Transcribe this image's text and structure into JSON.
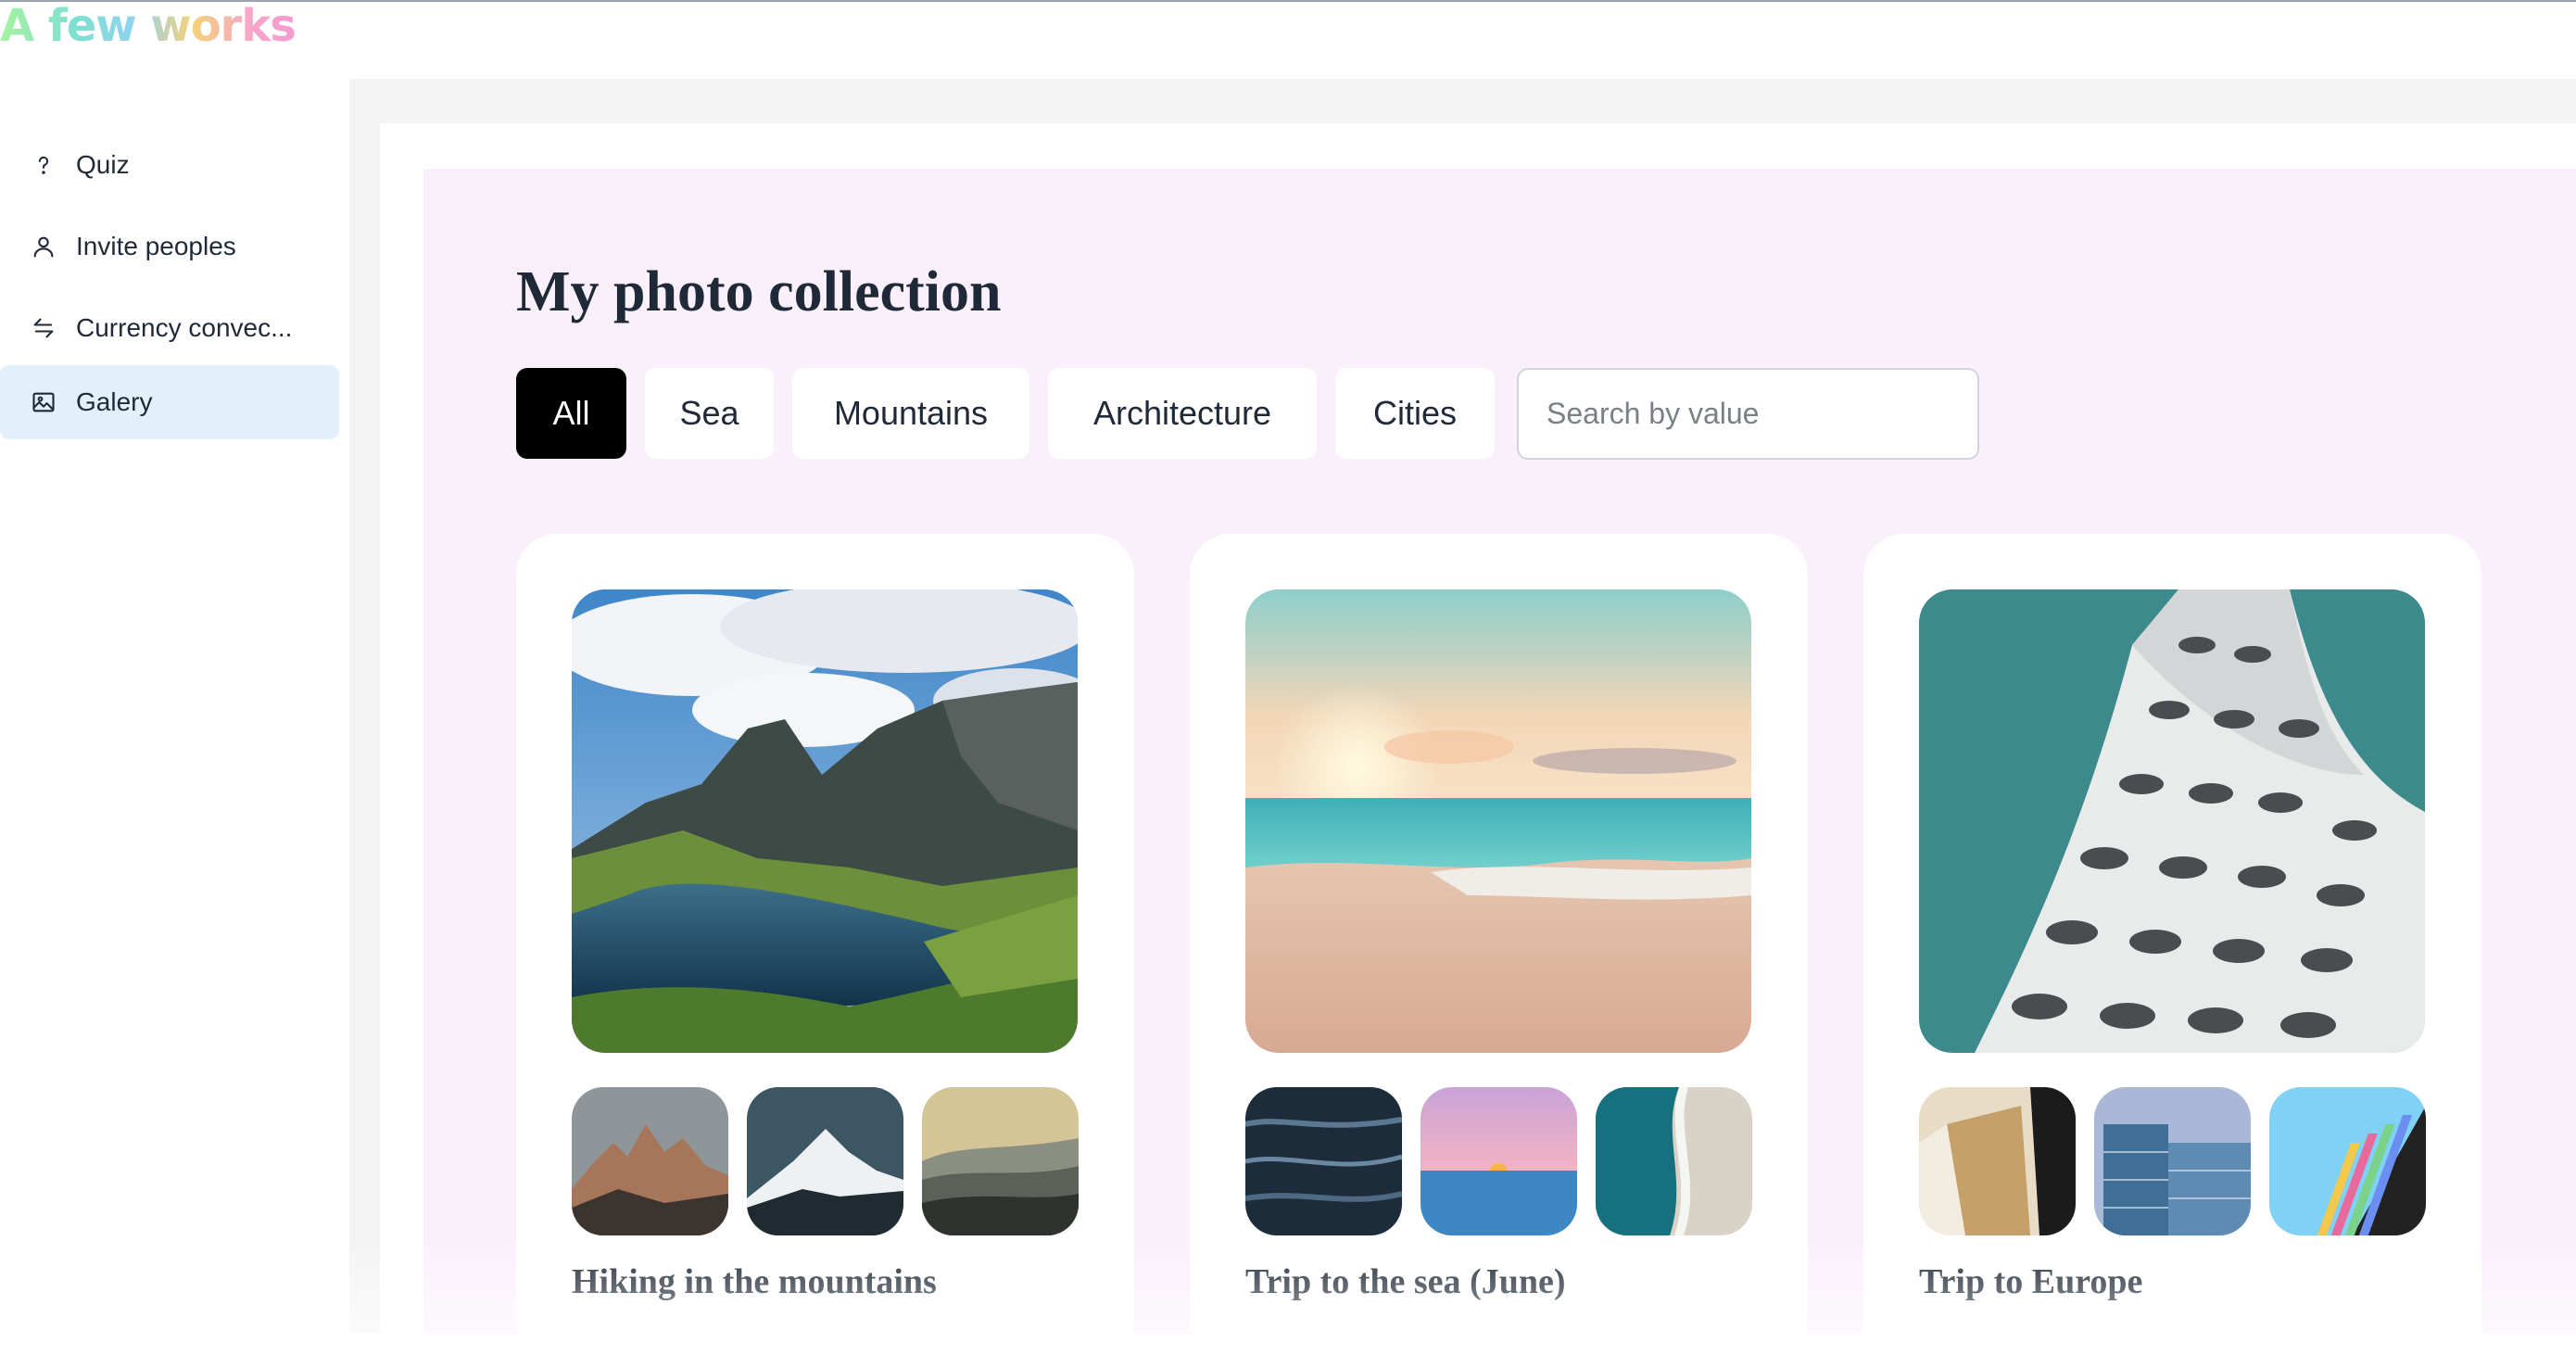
{
  "app": {
    "logo_text": "A few works"
  },
  "sidebar": {
    "items": [
      {
        "label": "Quiz",
        "icon": "question-icon",
        "active": false
      },
      {
        "label": "Invite peoples",
        "icon": "user-icon",
        "active": false
      },
      {
        "label": "Currency convec...",
        "icon": "swap-arrows-icon",
        "active": false
      },
      {
        "label": "Galery",
        "icon": "image-icon",
        "active": true
      }
    ]
  },
  "main": {
    "title": "My photo collection",
    "filters": [
      "All",
      "Sea",
      "Mountains",
      "Architecture",
      "Cities"
    ],
    "active_filter": "All",
    "search": {
      "placeholder": "Search by value",
      "value": ""
    },
    "cards": [
      {
        "title": "Hiking in the mountains",
        "photo": "mountain-lake-photo",
        "thumbs": [
          "rocky-peaks-photo",
          "snowy-peak-photo",
          "misty-ridges-photo"
        ]
      },
      {
        "title": "Trip to the sea (June)",
        "photo": "beach-sunset-photo",
        "thumbs": [
          "dark-waves-photo",
          "pink-sea-sunset-photo",
          "aerial-shore-photo"
        ]
      },
      {
        "title": "Trip to Europe",
        "photo": "white-building-photo",
        "thumbs": [
          "beige-architecture-photo",
          "glass-tower-photo",
          "colorful-facade-photo"
        ]
      }
    ]
  },
  "colors": {
    "active_nav": "#e3f0fb",
    "panel_bg": "#faf0fc",
    "active_chip": "#000000"
  }
}
